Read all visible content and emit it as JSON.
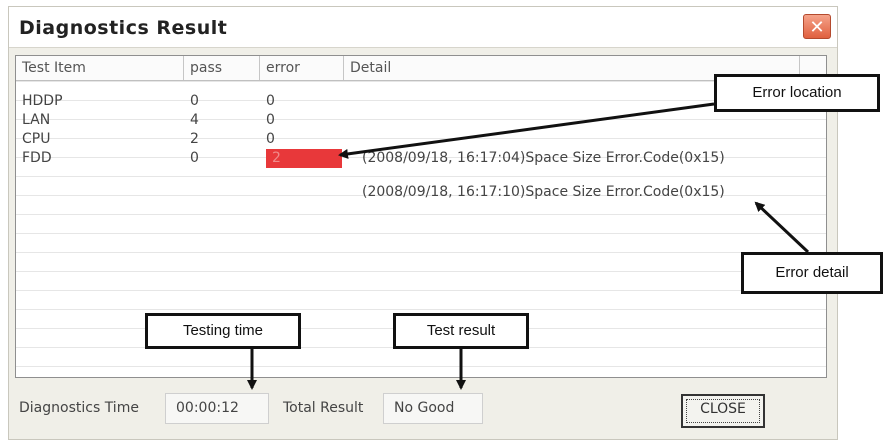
{
  "window": {
    "title": "Diagnostics Result",
    "close_icon": "close-icon"
  },
  "table": {
    "columns": [
      "Test Item",
      "pass",
      "error",
      "Detail"
    ],
    "rows": [
      {
        "item": "HDDP",
        "pass": "0",
        "error": "0",
        "detail": ""
      },
      {
        "item": "LAN",
        "pass": "4",
        "error": "0",
        "detail": ""
      },
      {
        "item": "CPU",
        "pass": "2",
        "error": "0",
        "detail": ""
      },
      {
        "item": "FDD",
        "pass": "0",
        "error": "2",
        "detail": "(2008/09/18, 16:17:04)Space Size Error.Code(0x15)",
        "error_highlight": "#e8383a"
      }
    ],
    "extra_detail": "(2008/09/18, 16:17:10)Space Size Error.Code(0x15)"
  },
  "footer": {
    "diagnostics_time_label": "Diagnostics Time",
    "diagnostics_time_value": "00:00:12",
    "total_result_label": "Total Result",
    "total_result_value": "No Good",
    "close_button": "CLOSE"
  },
  "annotations": {
    "error_location": "Error location",
    "error_detail": "Error detail",
    "testing_time": "Testing time",
    "test_result": "Test result"
  }
}
